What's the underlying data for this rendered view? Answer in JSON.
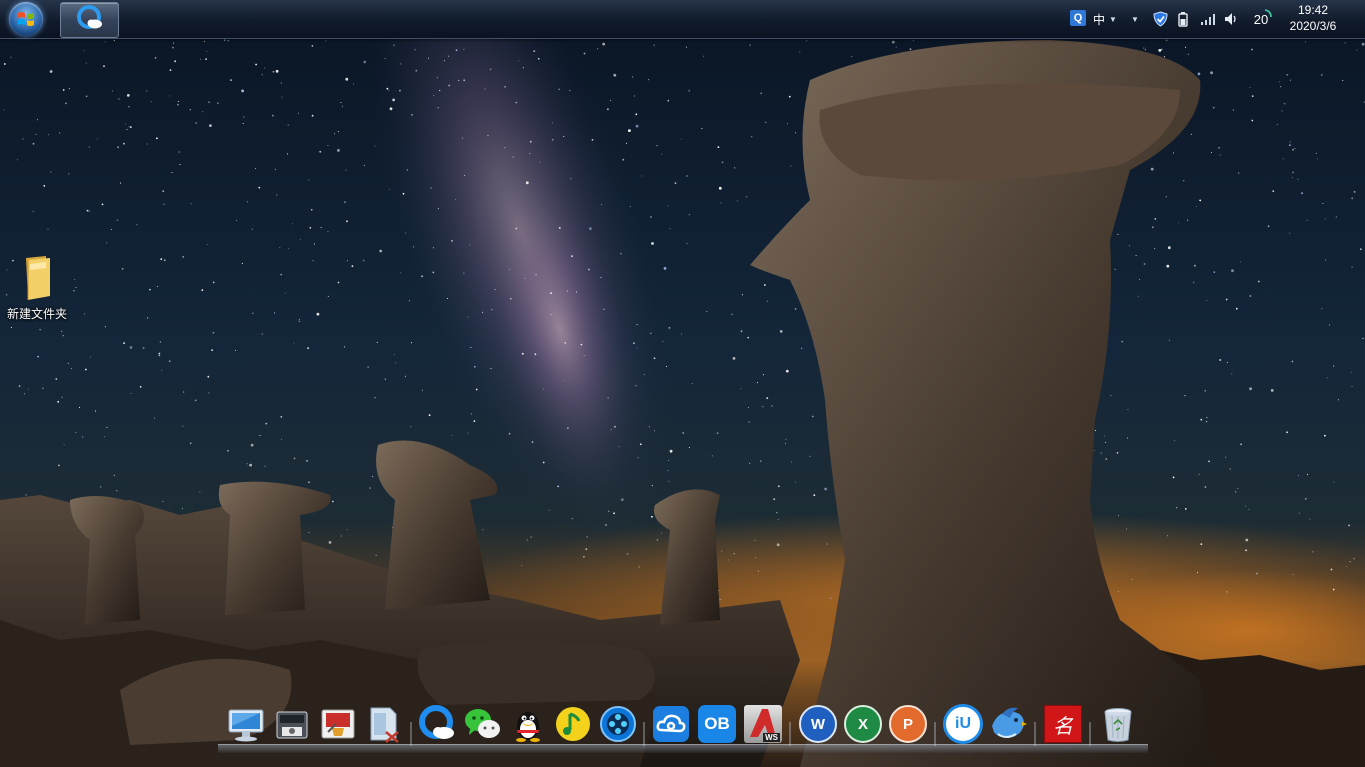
{
  "taskbar": {
    "start_icon": "windows-orb-icon",
    "pinned_app_icon": "browser-q-icon",
    "tray": {
      "ime_icon": "Q",
      "ime_mode": "中",
      "temperature": "20"
    },
    "clock": {
      "time": "19:42",
      "date": "2020/3/6"
    }
  },
  "desktop": {
    "icons": [
      {
        "label": "新建文件夹",
        "icon": "folder-icon"
      }
    ]
  },
  "dock": {
    "apps": [
      "computer-icon",
      "camera-scanner-icon",
      "toolbox-icon",
      "file-tool-icon",
      "browser-q-icon",
      "wechat-icon",
      "qq-penguin-icon",
      "music-note-icon",
      "video-player-icon",
      "cloud-drive-icon",
      "ob-icon",
      "autocad-ws-icon",
      "word-icon",
      "excel-icon",
      "powerpoint-icon",
      "iu-icon",
      "bird-icon",
      "red-seal-icon",
      "recycle-bin-icon"
    ],
    "labels": {
      "ob": "OB",
      "ws": "WS",
      "word": "W",
      "excel": "X",
      "ppt": "P",
      "iu": "iU",
      "seal": "名"
    }
  },
  "colors": {
    "sky_top": "#0a1626",
    "sky_glow": "#a86b2a",
    "rock": "#3e342c",
    "taskbar": "#111b2b",
    "accent_blue": "#1f7bd9"
  }
}
